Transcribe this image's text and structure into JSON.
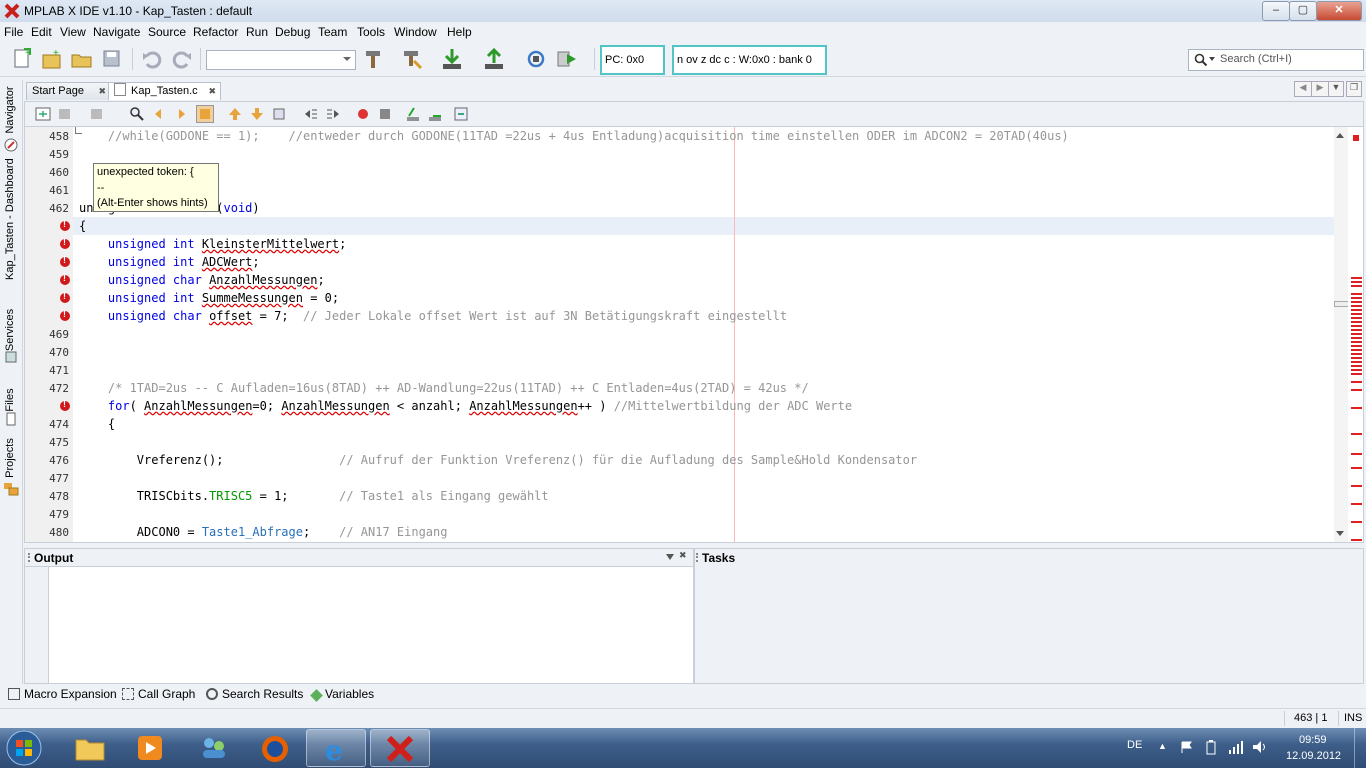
{
  "window": {
    "title": "MPLAB X IDE v1.10 - Kap_Tasten : default",
    "buttons": [
      "–",
      "▢",
      "✕"
    ]
  },
  "menu": [
    "File",
    "Edit",
    "View",
    "Navigate",
    "Source",
    "Refactor",
    "Run",
    "Debug",
    "Team",
    "Tools",
    "Window",
    "Help"
  ],
  "toolbar": {
    "config_combo_value": "",
    "pc_label": "PC: 0x0",
    "status_label": "n ov z dc c  : W:0x0 : bank 0",
    "search_placeholder": "Search (Ctrl+I)"
  },
  "left_rail": [
    "Navigator",
    "Kap_Tasten - Dashboard",
    "Services",
    "Files",
    "Projects"
  ],
  "editor_tabs": [
    {
      "label": "Start Page",
      "active": false
    },
    {
      "label": "Kap_Tasten.c",
      "active": true
    }
  ],
  "editor": {
    "line_numbers": [
      "458",
      "459",
      "460",
      "461",
      "462",
      "",
      "",
      "",
      "",
      "",
      "",
      "469",
      "470",
      "471",
      "472",
      "",
      "474",
      "475",
      "476",
      "477",
      "478",
      "479",
      "480"
    ],
    "error_rows": [
      5,
      6,
      7,
      8,
      9,
      10,
      15
    ],
    "tooltip": [
      "unexpected token: {",
      "--",
      "(Alt-Enter shows hints)"
    ],
    "lines": [
      [
        {
          "t": "    "
        },
        {
          "t": "//while(GODONE == 1);    //entweder durch GODONE(11TAD =22us + 4us Entladung)acquisition time einstellen ODER im ADCON2 = 20TAD(40us)",
          "c": "c-comment"
        }
      ],
      [],
      [],
      [],
      [
        {
          "t": "unsigned int Taste1(",
          "c": ""
        },
        {
          "t": "void",
          "c": "c-kw"
        },
        {
          "t": ")"
        }
      ],
      [
        {
          "t": "{"
        }
      ],
      [
        {
          "t": "    "
        },
        {
          "t": "unsigned int ",
          "c": "c-kw"
        },
        {
          "t": "KleinsterMittelwert",
          "c": "c-id"
        },
        {
          "t": ";"
        }
      ],
      [
        {
          "t": "    "
        },
        {
          "t": "unsigned int ",
          "c": "c-kw"
        },
        {
          "t": "ADCWert",
          "c": "c-id"
        },
        {
          "t": ";"
        }
      ],
      [
        {
          "t": "    "
        },
        {
          "t": "unsigned char ",
          "c": "c-kw"
        },
        {
          "t": "AnzahlMessungen",
          "c": "c-id"
        },
        {
          "t": ";"
        }
      ],
      [
        {
          "t": "    "
        },
        {
          "t": "unsigned int ",
          "c": "c-kw"
        },
        {
          "t": "SummeMessungen",
          "c": "c-id"
        },
        {
          "t": " = 0;"
        }
      ],
      [
        {
          "t": "    "
        },
        {
          "t": "unsigned char ",
          "c": "c-kw"
        },
        {
          "t": "offset",
          "c": "c-id"
        },
        {
          "t": " = 7;  "
        },
        {
          "t": "// Jeder Lokale offset Wert ist auf 3N Betätigungskraft eingestellt",
          "c": "c-comment"
        }
      ],
      [],
      [],
      [],
      [
        {
          "t": "    "
        },
        {
          "t": "/* 1TAD=2us -- C Aufladen=16us(8TAD) ++ AD-Wandlung=22us(11TAD) ++ C Entladen=4us(2TAD) = 42us */",
          "c": "c-comment"
        }
      ],
      [
        {
          "t": "    "
        },
        {
          "t": "for",
          "c": "c-kw"
        },
        {
          "t": "( "
        },
        {
          "t": "AnzahlMessungen",
          "c": "c-id"
        },
        {
          "t": "=0; "
        },
        {
          "t": "AnzahlMessungen",
          "c": "c-id"
        },
        {
          "t": " < anzahl; "
        },
        {
          "t": "AnzahlMessungen",
          "c": "c-id"
        },
        {
          "t": "++ ) "
        },
        {
          "t": "//Mittelwertbildung der ADC Werte",
          "c": "c-comment"
        }
      ],
      [
        {
          "t": "    {"
        }
      ],
      [],
      [
        {
          "t": "        Vreferenz();                "
        },
        {
          "t": "// Aufruf der Funktion Vreferenz() für die Aufladung des Sample&Hold Kondensator",
          "c": "c-comment"
        }
      ],
      [],
      [
        {
          "t": "        TRISCbits."
        },
        {
          "t": "TRISC5",
          "c": "c-field"
        },
        {
          "t": " = 1;       "
        },
        {
          "t": "// Taste1 als Eingang gewählt",
          "c": "c-comment"
        }
      ],
      [],
      [
        {
          "t": "        ADCON0 = "
        },
        {
          "t": "Taste1_Abfrage",
          "c": "c-mac"
        },
        {
          "t": ";    "
        },
        {
          "t": "// AN17 Eingang",
          "c": "c-comment"
        }
      ]
    ]
  },
  "output": {
    "title": "Output"
  },
  "tasks": {
    "title": "Tasks"
  },
  "bottom_tabs": [
    "Macro Expansion",
    "Call Graph",
    "Search Results",
    "Variables"
  ],
  "status": {
    "position": "463 | 1",
    "mode": "INS"
  },
  "taskbar": {
    "language": "DE",
    "time": "09:59",
    "date": "12.09.2012"
  },
  "colors": {
    "error": "#d21919",
    "margin": "#ffb7b7",
    "cyan_box": "#4fc5c8"
  }
}
